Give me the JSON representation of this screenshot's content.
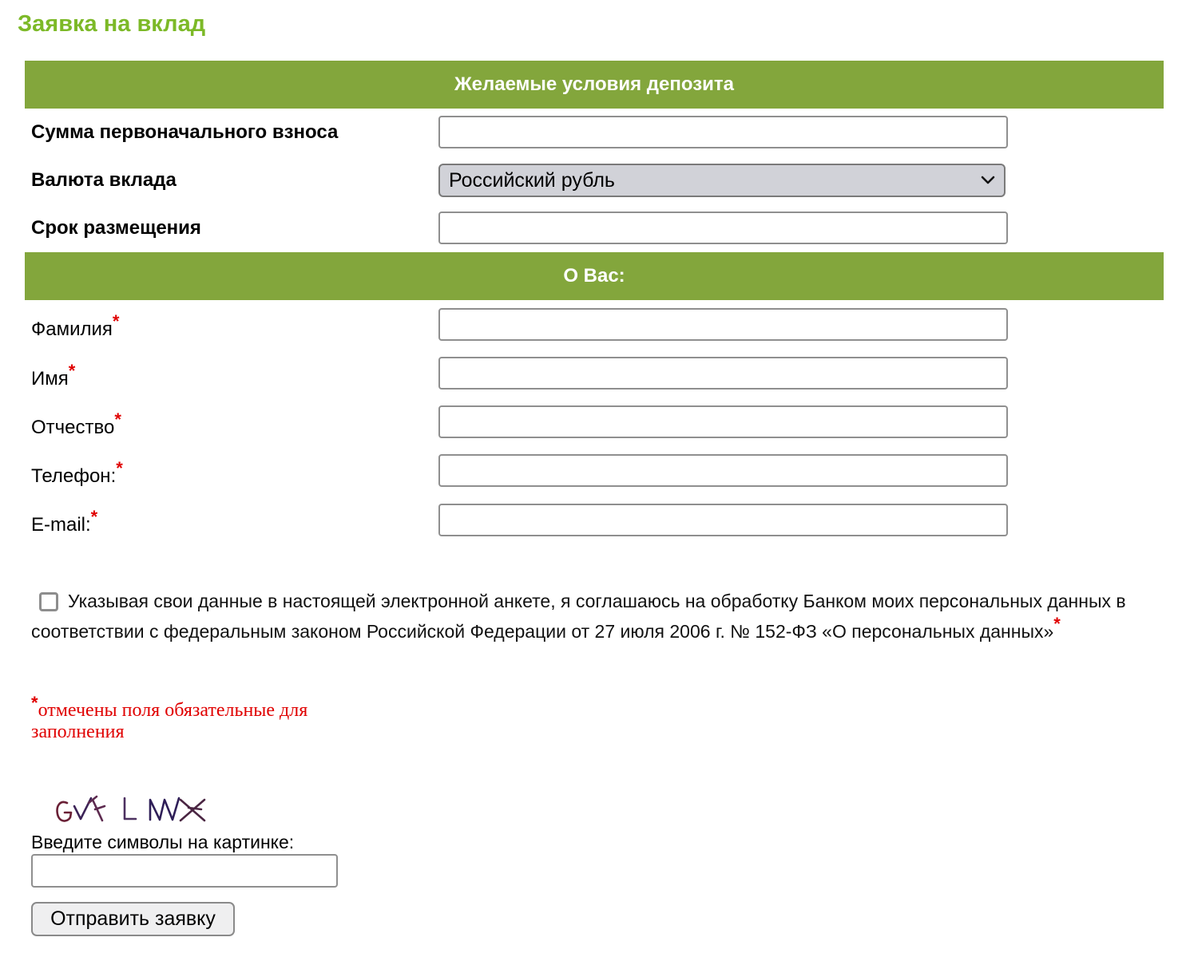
{
  "page": {
    "title": "Заявка на вклад"
  },
  "sections": {
    "deposit": {
      "header": "Желаемые условия депозита"
    },
    "about": {
      "header": "О Вас:"
    }
  },
  "deposit_fields": {
    "amount": {
      "label": "Сумма первоначального взноса",
      "value": ""
    },
    "currency": {
      "label": "Валюта вклада",
      "selected": "Российский рубль"
    },
    "term": {
      "label": "Срок размещения",
      "value": ""
    }
  },
  "personal_fields": {
    "last_name": {
      "label": "Фамилия",
      "value": ""
    },
    "first_name": {
      "label": "Имя",
      "value": ""
    },
    "middle_name": {
      "label": "Отчество",
      "value": ""
    },
    "phone": {
      "label": "Телефон:",
      "value": ""
    },
    "email": {
      "label": "E-mail:",
      "value": ""
    }
  },
  "required_mark": "*",
  "consent": {
    "checked": false,
    "text": "Указывая свои данные в настоящей электронной анкете, я соглашаюсь на обработку Банком моих персональных данных в соответствии с федеральным законом Российской Федерации от 27 июля 2006 г. № 152-ФЗ «О персональных данных»"
  },
  "required_note": "отмечены поля обязательные для заполнения",
  "captcha": {
    "image_text": "GVX L NWX",
    "label": "Введите символы на картинке:",
    "value": ""
  },
  "submit": {
    "label": "Отправить заявку"
  },
  "colors": {
    "title": "#7cb927",
    "section_header_bg": "#83a63c",
    "required": "#e00000"
  },
  "icons": {
    "select_arrow": "chevron-down-icon"
  }
}
